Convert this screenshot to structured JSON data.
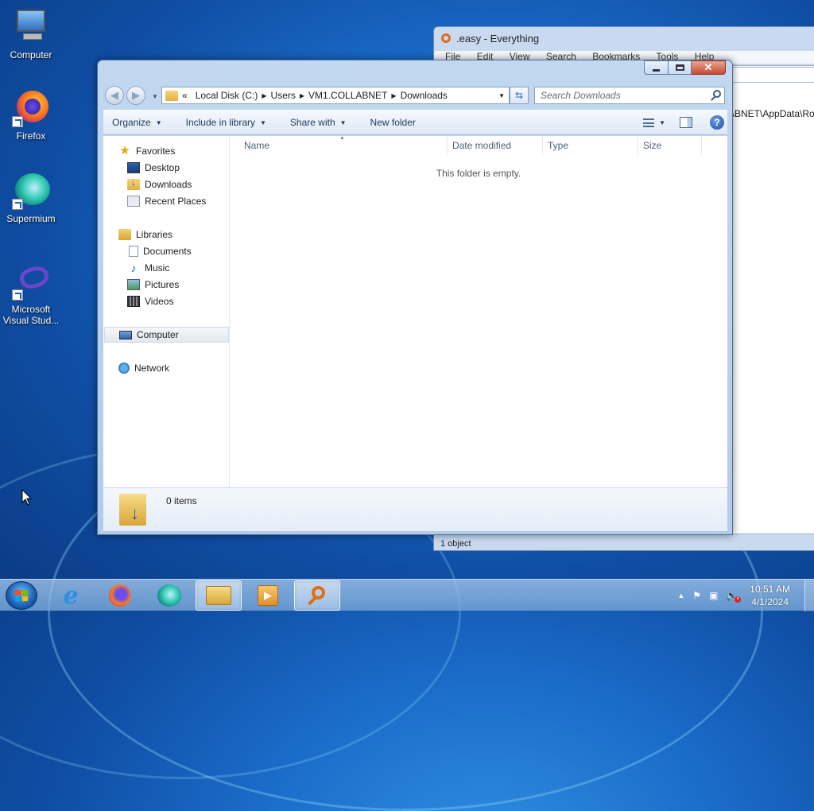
{
  "desktop": {
    "icons": [
      {
        "label": "Computer"
      },
      {
        "label": "Firefox"
      },
      {
        "label": "Supermium"
      },
      {
        "label": "Microsoft Visual Stud..."
      }
    ]
  },
  "background_window": {
    "title": ".easy - Everything",
    "menu": [
      "File",
      "Edit",
      "View",
      "Search",
      "Bookmarks",
      "Tools",
      "Help"
    ],
    "path_fragment": "ABNET\\AppData\\Ro",
    "status": "1 object"
  },
  "explorer": {
    "address": {
      "overflow": "«",
      "crumbs": [
        "Local Disk (C:)",
        "Users",
        "VM1.COLLABNET",
        "Downloads"
      ]
    },
    "search_placeholder": "Search Downloads",
    "toolbar": {
      "organize": "Organize",
      "include_in_library": "Include in library",
      "share_with": "Share with",
      "new_folder": "New folder"
    },
    "nav": {
      "favorites": "Favorites",
      "desktop": "Desktop",
      "downloads": "Downloads",
      "recent_places": "Recent Places",
      "libraries": "Libraries",
      "documents": "Documents",
      "music": "Music",
      "pictures": "Pictures",
      "videos": "Videos",
      "computer": "Computer",
      "network": "Network"
    },
    "columns": [
      "Name",
      "Date modified",
      "Type",
      "Size"
    ],
    "empty_message": "This folder is empty.",
    "details": {
      "count": "0 items"
    }
  },
  "taskbar": {
    "clock_time": "10:51 AM",
    "clock_date": "4/1/2024"
  }
}
